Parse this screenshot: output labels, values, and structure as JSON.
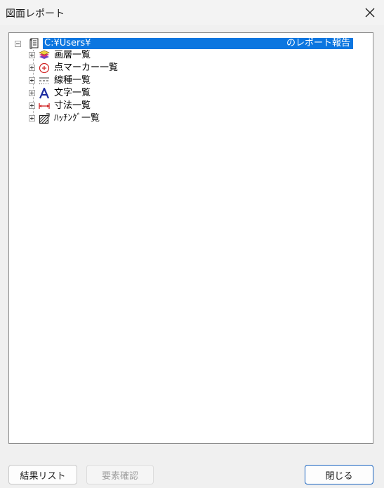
{
  "window": {
    "title": "図面レポート"
  },
  "tree": {
    "root": {
      "path": "C:¥Users¥",
      "suffix": "のレポート報告"
    },
    "children": [
      {
        "label": "画層一覧",
        "icon": "layer-icon"
      },
      {
        "label": "点マーカー一覧",
        "icon": "point-marker-icon"
      },
      {
        "label": "線種一覧",
        "icon": "linetype-icon"
      },
      {
        "label": "文字一覧",
        "icon": "text-icon"
      },
      {
        "label": "寸法一覧",
        "icon": "dimension-icon"
      },
      {
        "label": "ﾊｯﾁﾝｸﾞ一覧",
        "icon": "hatching-icon"
      }
    ]
  },
  "buttons": {
    "result_list": "結果リスト",
    "element_check": "要素確認",
    "close": "閉じる"
  },
  "colors": {
    "selection": "#0c76e0",
    "primary_border": "#1a64c0"
  }
}
